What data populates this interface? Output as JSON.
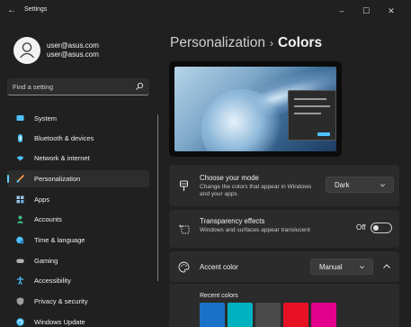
{
  "titlebar": {
    "back_glyph": "←",
    "title": "Settings",
    "minimize_glyph": "–",
    "maximize_glyph": "☐",
    "close_glyph": "✕"
  },
  "profile": {
    "name": "user@asus.com",
    "email": "user@asus.com"
  },
  "search": {
    "placeholder": "Find a setting"
  },
  "nav": {
    "items": [
      {
        "label": "System",
        "icon": "monitor-icon",
        "color": "#4cc2ff"
      },
      {
        "label": "Bluetooth & devices",
        "icon": "bluetooth-icon",
        "color": "#4cc2ff"
      },
      {
        "label": "Network & internet",
        "icon": "wifi-icon",
        "color": "#4cc2ff"
      },
      {
        "label": "Personalization",
        "icon": "brush-icon",
        "color": "#ff9c4a",
        "selected": true
      },
      {
        "label": "Apps",
        "icon": "apps-icon",
        "color": "#9ec4e8"
      },
      {
        "label": "Accounts",
        "icon": "person-icon",
        "color": "#3fc285"
      },
      {
        "label": "Time & language",
        "icon": "globe-clock-icon",
        "color": "#4cc2ff"
      },
      {
        "label": "Gaming",
        "icon": "gamepad-icon",
        "color": "#b0b0b0"
      },
      {
        "label": "Accessibility",
        "icon": "accessibility-icon",
        "color": "#4cc2ff"
      },
      {
        "label": "Privacy & security",
        "icon": "shield-icon",
        "color": "#9e9e9e"
      },
      {
        "label": "Windows Update",
        "icon": "update-icon",
        "color": "#4cc2ff"
      }
    ]
  },
  "main": {
    "breadcrumb_parent": "Personalization",
    "breadcrumb_sep": "›",
    "breadcrumb_current": "Colors",
    "mode": {
      "title": "Choose your mode",
      "desc": "Change the colors that appear in Windows and your apps",
      "value": "Dark"
    },
    "transparency": {
      "title": "Transparency effects",
      "desc": "Windows and surfaces appear translucent",
      "state": "Off"
    },
    "accent": {
      "title": "Accent color",
      "value": "Manual"
    },
    "recent": {
      "label": "Recent colors",
      "colors": [
        "#1a72c8",
        "#00b2bf",
        "#4a4a4a",
        "#e81123",
        "#e3008c"
      ]
    }
  },
  "colors": {
    "accent": "#60cdff",
    "background": "#202020",
    "card": "#2b2b2b"
  }
}
